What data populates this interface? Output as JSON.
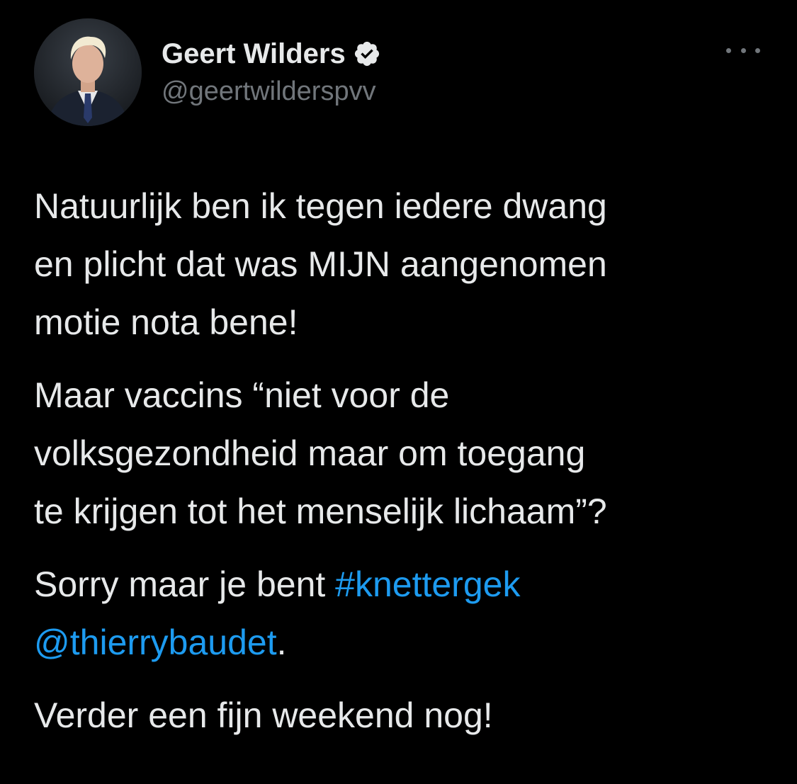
{
  "author": {
    "display_name": "Geert Wilders",
    "handle": "@geertwilderspvv",
    "verified": true,
    "avatar_icon": "profile-photo"
  },
  "menu": {
    "icon": "more-options-icon"
  },
  "tweet": {
    "paragraph_1": "Natuurlijk ben ik tegen iedere dwang\nen plicht dat was MIJN aangenomen\nmotie nota bene!",
    "paragraph_2": "Maar vaccins “niet voor de\nvolksgezondheid maar om toegang\nte krijgen tot het menselijk lichaam”?",
    "paragraph_3_prefix": "Sorry maar je bent ",
    "hashtag": "#knettergek",
    "mention": "@thierrybaudet",
    "paragraph_3_suffix": ".",
    "paragraph_4": "Verder een fijn weekend nog!"
  },
  "colors": {
    "background": "#000000",
    "text": "#e7e9ea",
    "secondary": "#71767b",
    "link": "#1d9bf0"
  }
}
